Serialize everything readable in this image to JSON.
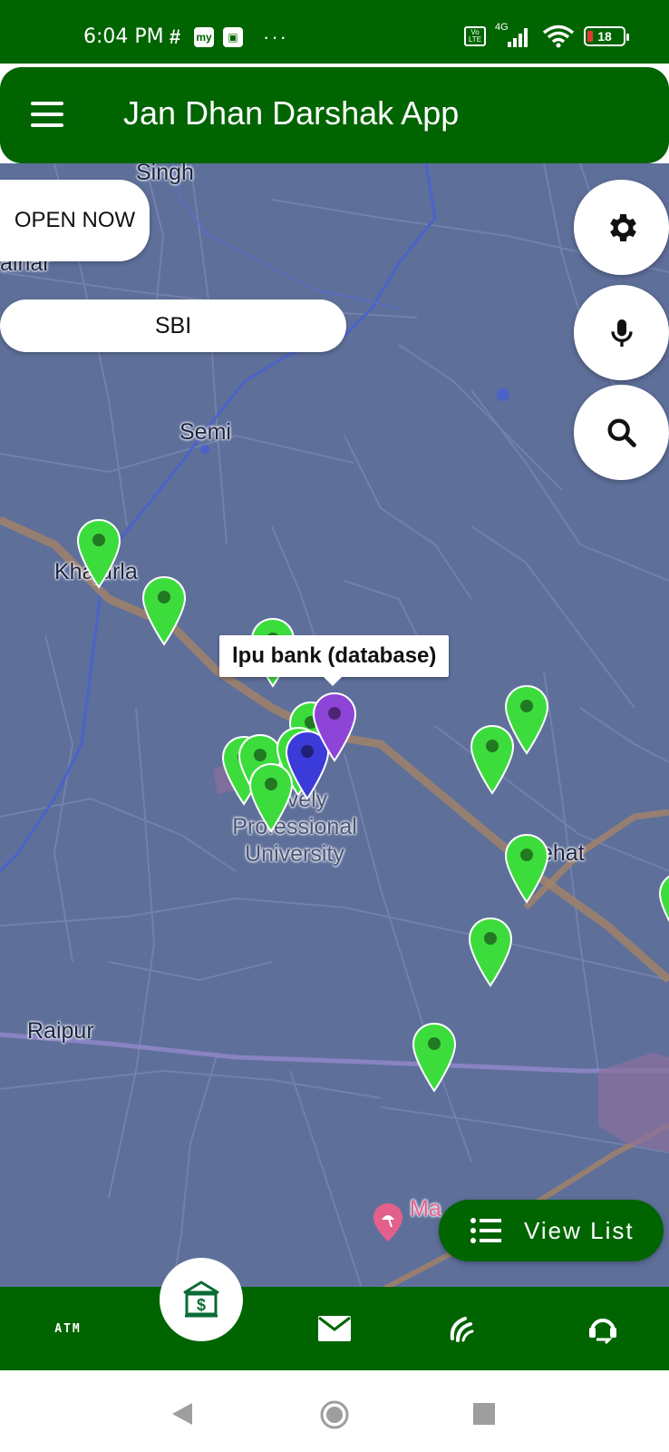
{
  "status_bar": {
    "time": "6:04 PM",
    "network": "4G",
    "volte": "Vo LTE",
    "battery": "18",
    "more": "···"
  },
  "app_bar": {
    "title": "Jan Dhan Darshak App"
  },
  "filters": {
    "open_now_label": "OPEN NOW",
    "bank_filter_label": "SBI"
  },
  "map": {
    "places": {
      "singh": "Singh",
      "jalahar": "alhar",
      "semi": "Semi",
      "khajurla": "Khajurla",
      "campus_line1": "Lovely",
      "campus_line2": "Professional",
      "campus_line3": "University",
      "mehat": "ehat",
      "raipur": "Raipur",
      "ma": "Ma"
    },
    "selected_marker_label": "lpu bank (database)",
    "marker_colors": {
      "bank": "#3ddc3d",
      "selected": "#8e44d6",
      "user": "#3b3bd9",
      "water": "#4b63c9",
      "road": "#a0826a"
    }
  },
  "fabs": [
    "gear-icon",
    "microphone-icon",
    "search-icon"
  ],
  "view_list": {
    "label": "View List"
  },
  "bottom_nav": {
    "atm_label": "ATM",
    "items": [
      "bank-icon",
      "mail-icon",
      "mitra-icon",
      "help-icon"
    ]
  }
}
